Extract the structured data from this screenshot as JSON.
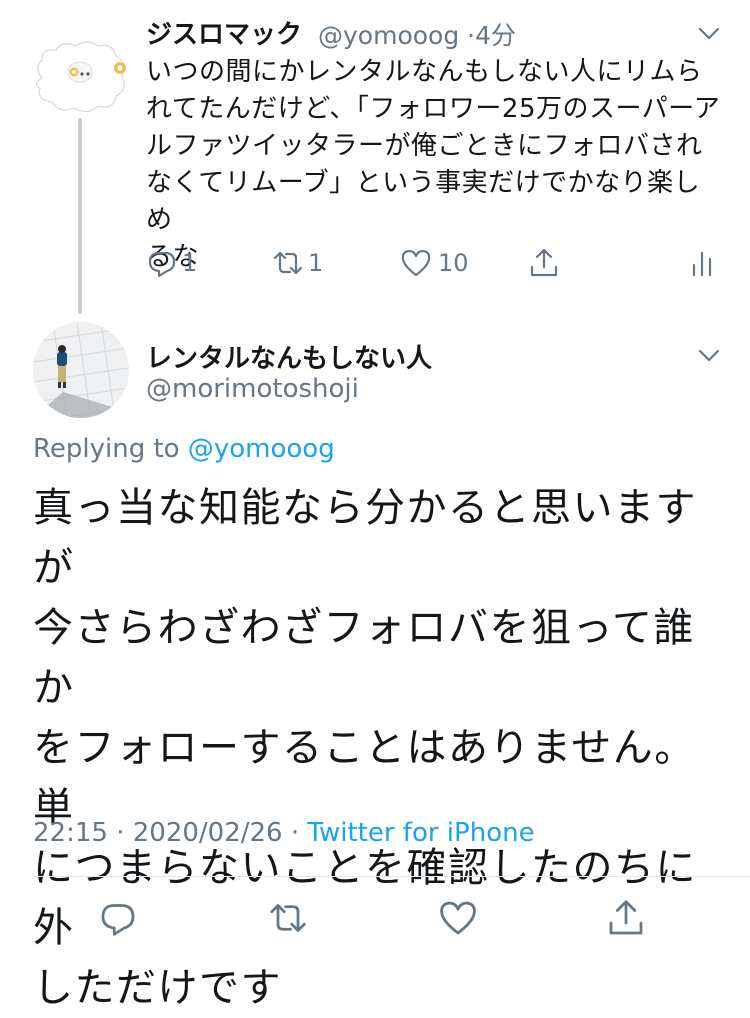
{
  "tweet1": {
    "author_name": "ジスロマック",
    "handle": "@yomooog",
    "separator": "·",
    "time": "4分",
    "lines": [
      "いつの間にかレンタルなんもしない人にリムら",
      "れてたんだけど、「フォロワー25万のスーパーア",
      "ルファツイッタラーが俺ごときにフォロバされ",
      "なくてリムーブ」という事実だけでかなり楽しめ",
      "るな"
    ],
    "reply_count": "1",
    "retweet_count": "1",
    "like_count": "10"
  },
  "tweet2": {
    "author_name": "レンタルなんもしない人",
    "handle": "@morimotoshoji",
    "replying_prefix": "Replying to",
    "replying_handle": "@yomooog",
    "lines": [
      "真っ当な知能なら分かると思いますが",
      "今さらわざわざフォロバを狙って誰か",
      "をフォローすることはありません。単",
      "につまらないことを確認したのちに外",
      "しただけです"
    ],
    "time": "22:15",
    "sep1": "·",
    "date": "2020/02/26",
    "sep2": "·",
    "source": "Twitter for iPhone"
  },
  "icons": {
    "caret": "chevron-down-icon",
    "reply": "reply-icon",
    "retweet": "retweet-icon",
    "like": "like-icon",
    "share": "share-icon",
    "analytics": "analytics-icon"
  },
  "colors": {
    "text": "#14171a",
    "secondary": "#657786",
    "link": "#1da1f2",
    "thread_line": "#c4cfd6",
    "divider": "#e1e8ed"
  }
}
